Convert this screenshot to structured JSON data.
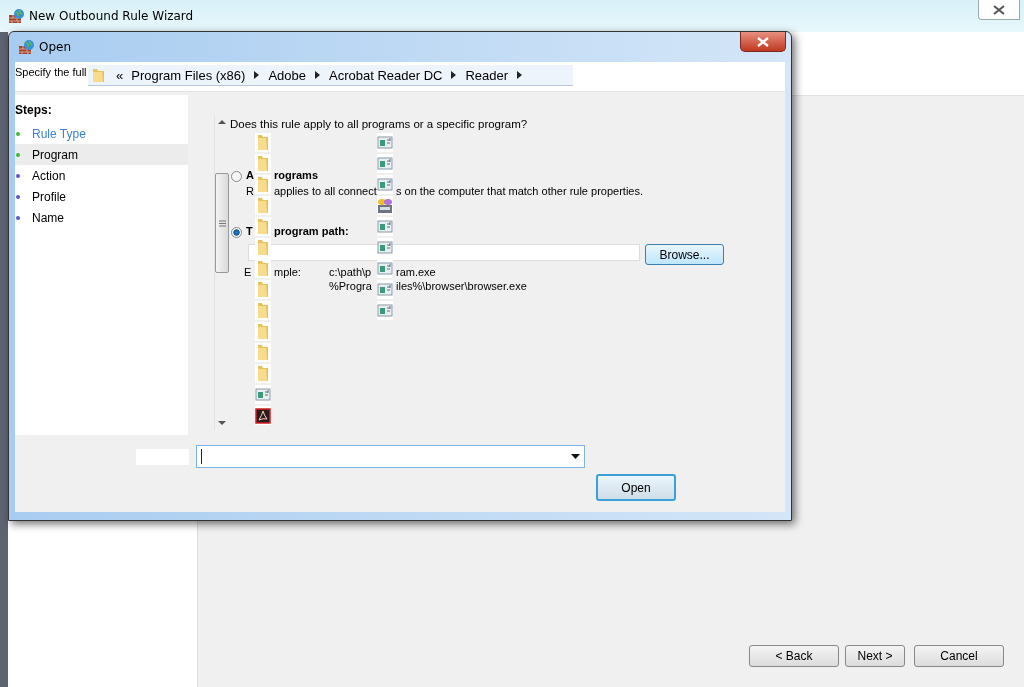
{
  "wizard": {
    "title": "New Outbound Rule Wizard",
    "buttons": [
      {
        "label": "< Back"
      },
      {
        "label": "Next >"
      },
      {
        "label": "Cancel"
      }
    ]
  },
  "dialog": {
    "title": "Open",
    "header_text": "Specify the full",
    "breadcrumb": {
      "overflow": "«",
      "parts": [
        "Program Files (x86)",
        "Adobe",
        "Acrobat Reader DC",
        "Reader"
      ]
    },
    "steps_heading": "Steps:",
    "steps": [
      {
        "label": "Rule Type",
        "color": "#3fb92f",
        "selected": false,
        "hovered": true
      },
      {
        "label": "Program",
        "color": "#3fb92f",
        "selected": true,
        "hovered": false
      },
      {
        "label": "Action",
        "color": "#5a55c8",
        "selected": false,
        "hovered": false
      },
      {
        "label": "Profile",
        "color": "#5a55c8",
        "selected": false,
        "hovered": false
      },
      {
        "label": "Name",
        "color": "#5a55c8",
        "selected": false,
        "hovered": false
      }
    ],
    "question": "Does this rule apply to all programs or a specific program?",
    "options": [
      {
        "selected": false,
        "label_parts": [
          "A",
          "rograms"
        ],
        "description_parts": [
          "R",
          "applies to all connect",
          "s on the computer that match other rule properties."
        ]
      },
      {
        "selected": true,
        "label_parts": [
          "T",
          "program path:"
        ]
      }
    ],
    "browse_button": "Browse...",
    "example": {
      "label_parts": [
        "E",
        "mple:"
      ],
      "lines": [
        [
          "c:\\path\\p",
          "ram.exe"
        ],
        [
          "%Progra",
          "iles%\\browser\\browser.exe"
        ]
      ]
    },
    "open_button": "Open"
  }
}
